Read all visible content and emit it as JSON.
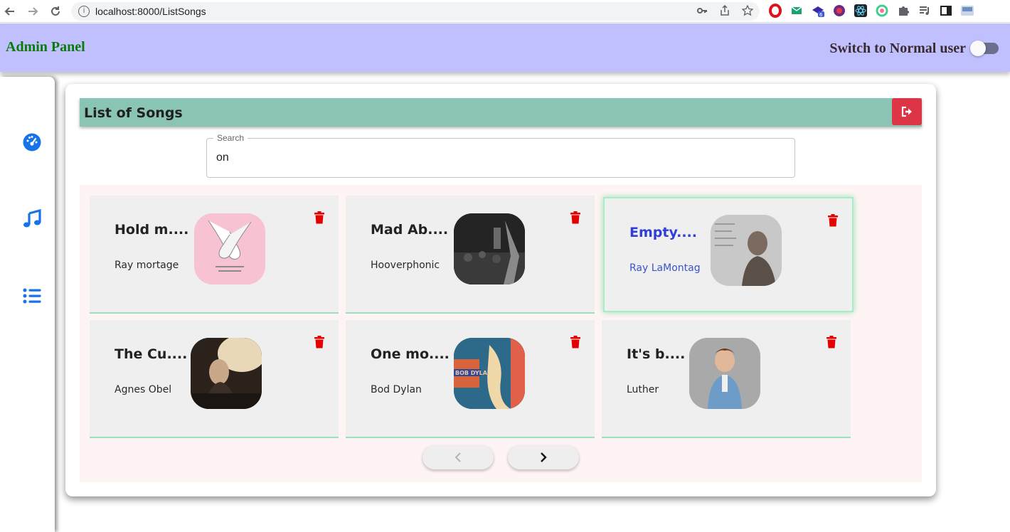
{
  "browser": {
    "url": "localhost:8000/ListSongs"
  },
  "header": {
    "brand": "Admin Panel",
    "switch_label": "Switch to Normal user"
  },
  "sidebar": {
    "items": [
      {
        "icon": "dashboard-icon"
      },
      {
        "icon": "music-icon"
      },
      {
        "icon": "list-icon"
      }
    ]
  },
  "panel": {
    "title": "List of Songs",
    "search_label": "Search",
    "search_value": "on"
  },
  "songs": [
    {
      "title": "Hold m....",
      "artist": "Ray mortage",
      "thumb": "pink hands"
    },
    {
      "title": "Mad Ab....",
      "artist": "Hooverphonic",
      "thumb": "concert"
    },
    {
      "title": "Empty....",
      "artist": "Ray LaMontag",
      "thumb": "portrait",
      "active": true
    },
    {
      "title": "The Cu....",
      "artist": "Agnes Obel",
      "thumb": "piano"
    },
    {
      "title": "One mo....",
      "artist": "Bod Dylan",
      "thumb": "bob dylan"
    },
    {
      "title": "It's b....",
      "artist": "Luther",
      "thumb": "kid"
    }
  ],
  "pagination": {
    "prev": "‹",
    "next": "›"
  },
  "colors": {
    "header_bg": "#c0c0ff",
    "brand": "#0a7a0a",
    "title_bar": "#8ac4b4",
    "logout": "#dc3545",
    "grid_bg": "#fff4f4",
    "card_bg": "#efefef",
    "accent_blue": "#1773e8",
    "trash_red": "#e20000"
  }
}
